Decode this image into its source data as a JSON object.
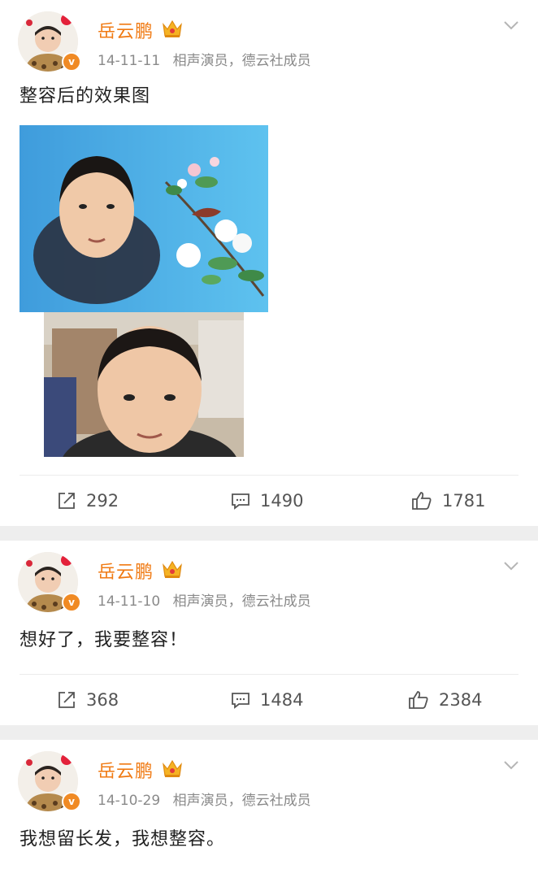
{
  "posts": [
    {
      "author": "岳云鹏",
      "date": "14-11-11",
      "tags": "相声演员，德云社成员",
      "text": "整容后的效果图",
      "verified_mark": "v",
      "has_images": true,
      "reposts": "292",
      "comments": "1490",
      "likes": "1781"
    },
    {
      "author": "岳云鹏",
      "date": "14-11-10",
      "tags": "相声演员，德云社成员",
      "text": "想好了，我要整容！",
      "verified_mark": "v",
      "has_images": false,
      "reposts": "368",
      "comments": "1484",
      "likes": "2384"
    },
    {
      "author": "岳云鹏",
      "date": "14-10-29",
      "tags": "相声演员，德云社成员",
      "text": "我想留长发，我想整容。",
      "verified_mark": "v",
      "has_images": false
    }
  ],
  "icons": {
    "repost": "repost-icon",
    "comment": "comment-icon",
    "like": "thumbs-up-icon",
    "crown": "crown-icon",
    "more": "chevron-down-icon"
  },
  "colors": {
    "username": "#f07a13",
    "meta": "#8a8a8a",
    "verify": "#f08a24",
    "image_bg": "#4fa9e3",
    "separator": "#eeeeee"
  }
}
